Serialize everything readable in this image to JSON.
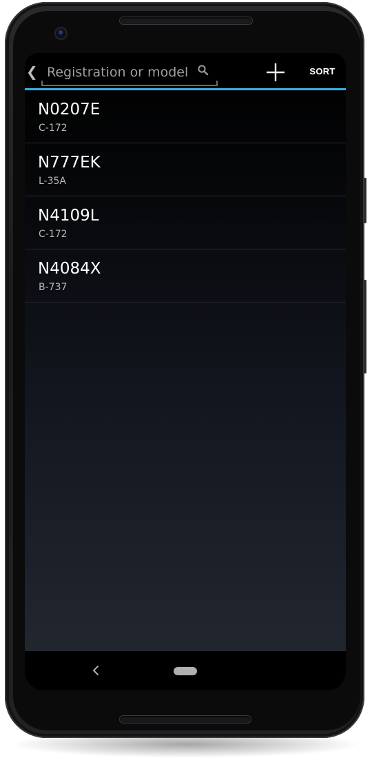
{
  "toolbar": {
    "search_placeholder": "Registration or model",
    "search_value": "",
    "back_icon": "chevron-left-icon",
    "search_icon": "search-icon",
    "add_icon": "plus-icon",
    "sort_label": "SORT",
    "accent_color": "#33b5e5"
  },
  "aircraft": [
    {
      "registration": "N0207E",
      "model": "C-172"
    },
    {
      "registration": "N777EK",
      "model": "L-35A"
    },
    {
      "registration": "N4109L",
      "model": "C-172"
    },
    {
      "registration": "N4084X",
      "model": "B-737"
    }
  ],
  "navbar": {
    "back_icon": "nav-back-icon",
    "home_icon": "home-pill-icon"
  }
}
